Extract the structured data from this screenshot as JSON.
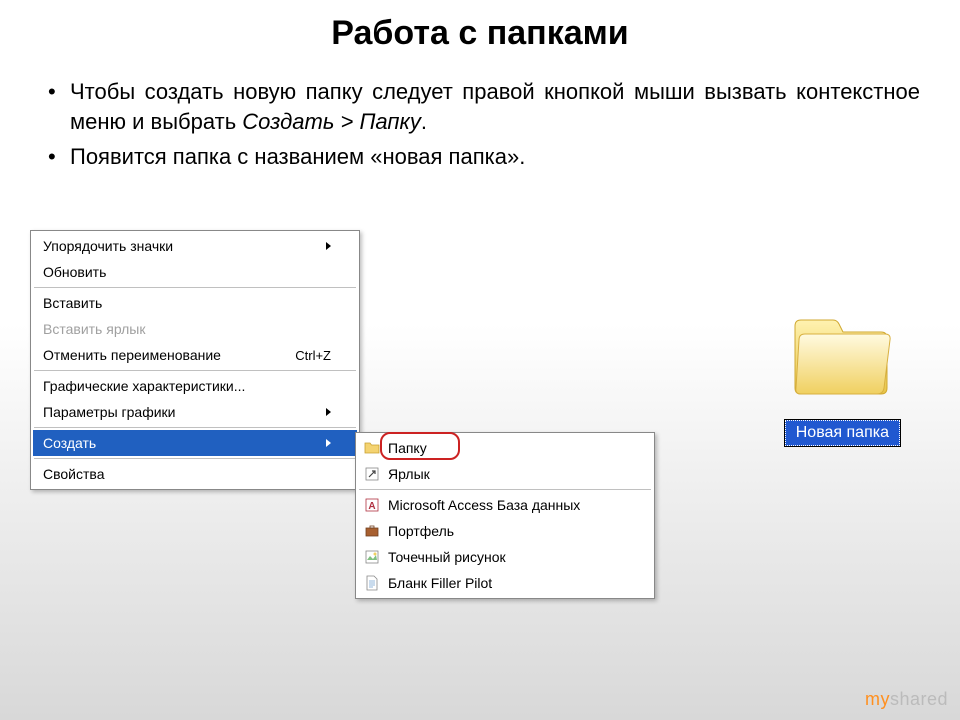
{
  "title": "Работа с папками",
  "bullets": {
    "item1_pre": "Чтобы создать новую папку следует правой кнопкой мыши вызвать контекстное меню и выбрать ",
    "item1_italic": "Создать > Папку",
    "item1_post": ".",
    "item2": "Появится папка с названием «новая папка»."
  },
  "contextMenu": {
    "sortIcons": "Упорядочить значки",
    "refresh": "Обновить",
    "paste": "Вставить",
    "pasteShortcut": "Вставить ярлык",
    "undoRename": "Отменить переименование",
    "undoRenameKey": "Ctrl+Z",
    "graphCharacteristics": "Графические характеристики...",
    "graphParams": "Параметры графики",
    "create": "Создать",
    "properties": "Свойства"
  },
  "submenu": {
    "folder": "Папку",
    "shortcut": "Ярлык",
    "access": "Microsoft Access База данных",
    "briefcase": "Портфель",
    "bitmap": "Точечный рисунок",
    "fillerPilot": "Бланк Filler Pilot"
  },
  "newFolder": {
    "label": "Новая папка"
  },
  "watermark": {
    "prefix": "my",
    "suffix": "shared"
  }
}
